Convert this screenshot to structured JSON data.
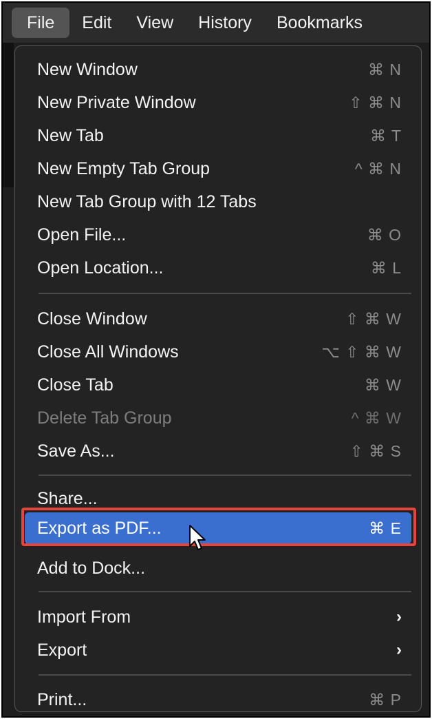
{
  "menubar": {
    "items": [
      {
        "label": "File"
      },
      {
        "label": "Edit"
      },
      {
        "label": "View"
      },
      {
        "label": "History"
      },
      {
        "label": "Bookmarks"
      }
    ]
  },
  "menu": {
    "new_window": {
      "label": "New Window",
      "shortcut": "⌘ N"
    },
    "new_private_window": {
      "label": "New Private Window",
      "shortcut": "⇧ ⌘ N"
    },
    "new_tab": {
      "label": "New Tab",
      "shortcut": "⌘ T"
    },
    "new_empty_tab_group": {
      "label": "New Empty Tab Group",
      "shortcut": "^ ⌘ N"
    },
    "new_tab_group_12": {
      "label": "New Tab Group with 12 Tabs",
      "shortcut": ""
    },
    "open_file": {
      "label": "Open File...",
      "shortcut": "⌘ O"
    },
    "open_location": {
      "label": "Open Location...",
      "shortcut": "⌘ L"
    },
    "close_window": {
      "label": "Close Window",
      "shortcut": "⇧ ⌘ W"
    },
    "close_all_windows": {
      "label": "Close All Windows",
      "shortcut": "⌥ ⇧ ⌘ W"
    },
    "close_tab": {
      "label": "Close Tab",
      "shortcut": "⌘ W"
    },
    "delete_tab_group": {
      "label": "Delete Tab Group",
      "shortcut": "^ ⌘ W"
    },
    "save_as": {
      "label": "Save As...",
      "shortcut": "⇧ ⌘ S"
    },
    "share": {
      "label": "Share..."
    },
    "export_pdf": {
      "label": "Export as PDF...",
      "shortcut": "⌘ E"
    },
    "add_to_dock": {
      "label": "Add to Dock..."
    },
    "import_from": {
      "label": "Import From",
      "arrow": "›"
    },
    "export": {
      "label": "Export",
      "arrow": "›"
    },
    "print": {
      "label": "Print...",
      "shortcut": "⌘ P"
    }
  },
  "colors": {
    "highlight": "#3a6fd0",
    "annotation_box": "#e5453c",
    "menu_bg": "#232323"
  }
}
